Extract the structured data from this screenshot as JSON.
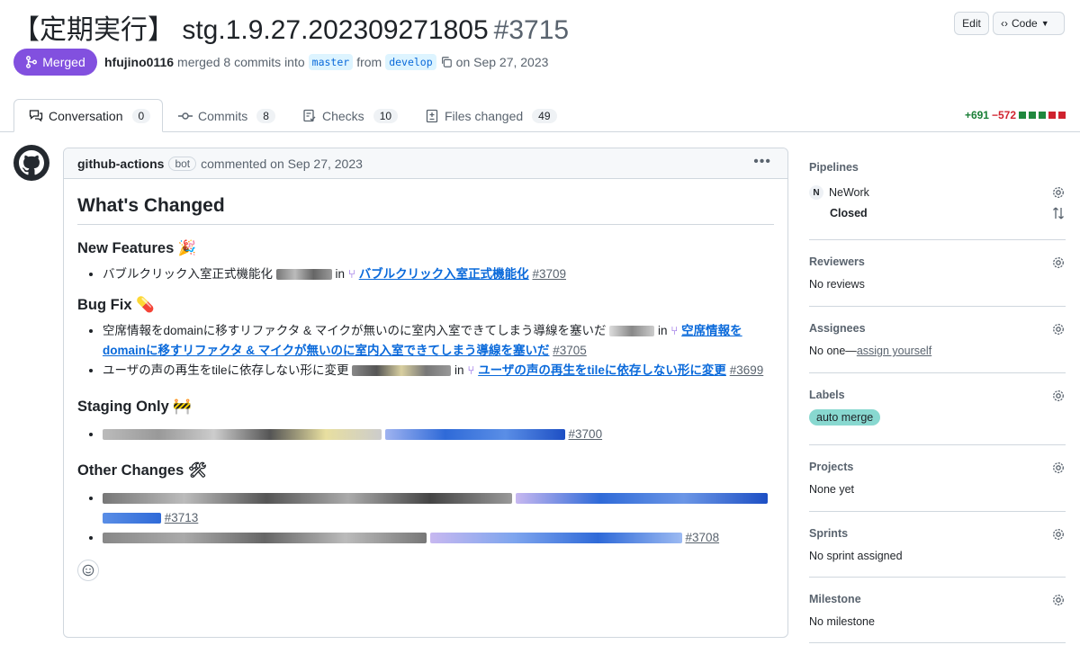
{
  "pr": {
    "title": "【定期実行】 stg.1.9.27.202309271805",
    "number": "#3715",
    "status": "Merged",
    "author": "hfujino0116",
    "merged_text": "merged 8 commits into",
    "base": "master",
    "from_text": "from",
    "head": "develop",
    "date_text": "on Sep 27, 2023"
  },
  "header_buttons": {
    "edit": "Edit",
    "code": "Code"
  },
  "tabs": [
    {
      "label": "Conversation",
      "count": "0"
    },
    {
      "label": "Commits",
      "count": "8"
    },
    {
      "label": "Checks",
      "count": "10"
    },
    {
      "label": "Files changed",
      "count": "49"
    }
  ],
  "diffstat": {
    "additions": "+691",
    "deletions": "−572"
  },
  "comment": {
    "author": "github-actions",
    "bot": "bot",
    "meta": "commented on Sep 27, 2023",
    "heading": "What's Changed",
    "sections": {
      "features": "New Features 🎉",
      "bugfix": "Bug Fix 💊",
      "staging": "Staging Only 🚧",
      "other": "Other Changes 🛠"
    },
    "items": {
      "f1_text": "バブルクリック入室正式機能化",
      "f1_in": "in",
      "f1_link": "バブルクリック入室正式機能化",
      "f1_num": "#3709",
      "b1_text": "空席情報をdomainに移すリファクタ & マイクが無いのに室内入室できてしまう導線を塞いだ",
      "b1_in": "in",
      "b1_link1": "空席情報を",
      "b1_link2": "domainに移すリファクタ & マイクが無いのに室内入室できてしまう導線を塞いだ",
      "b1_num": "#3705",
      "b2_text": "ユーザの声の再生をtileに依存しない形に変更",
      "b2_in": "in",
      "b2_link": "ユーザの声の再生をtileに依存しない形に変更",
      "b2_num": "#3699",
      "s1_num": "#3700",
      "o1_num": "#3713",
      "o2_num": "#3708"
    }
  },
  "sidebar": {
    "pipelines": {
      "title": "Pipelines",
      "workspace_initial": "N",
      "workspace": "NeWork",
      "state": "Closed"
    },
    "reviewers": {
      "title": "Reviewers",
      "value": "No reviews"
    },
    "assignees": {
      "title": "Assignees",
      "prefix": "No one—",
      "link": "assign yourself"
    },
    "labels": {
      "title": "Labels",
      "label": "auto merge"
    },
    "projects": {
      "title": "Projects",
      "value": "None yet"
    },
    "sprints": {
      "title": "Sprints",
      "value": "No sprint assigned"
    },
    "milestone": {
      "title": "Milestone",
      "value": "No milestone"
    }
  }
}
